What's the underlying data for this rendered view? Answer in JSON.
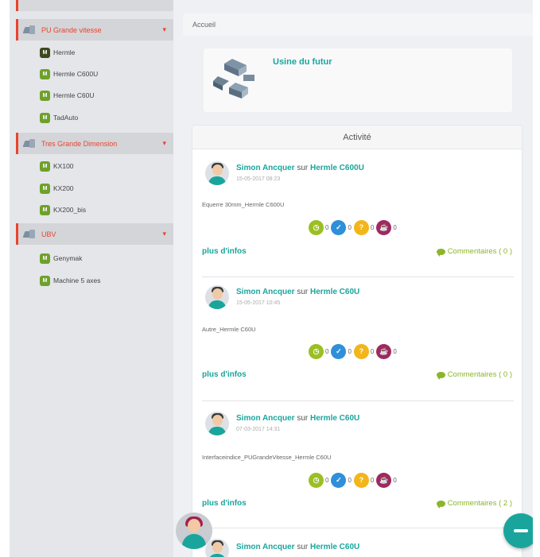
{
  "sidebar": {
    "groups": [
      {
        "label": "PU Grande vitesse",
        "items": [
          {
            "badge": "M",
            "label": "Hermle"
          },
          {
            "badge": "M",
            "label": "Hermle C600U"
          },
          {
            "badge": "M",
            "label": "Hermle C60U"
          },
          {
            "badge": "M",
            "label": "TadAuto"
          }
        ]
      },
      {
        "label": "Tres Grande Dimension",
        "items": [
          {
            "badge": "M",
            "label": "KX100"
          },
          {
            "badge": "M",
            "label": "KX200"
          },
          {
            "badge": "M",
            "label": "KX200_bis"
          }
        ]
      },
      {
        "label": "UBV",
        "items": [
          {
            "badge": "M",
            "label": "Genymak"
          },
          {
            "badge": "M",
            "label": "Machine 5 axes"
          }
        ]
      }
    ],
    "arrow": "▾"
  },
  "breadcrumb": "Accueil",
  "factory": {
    "title": "Usine du futur"
  },
  "activity": {
    "title": "Activité",
    "posts": [
      {
        "author": "Simon Ancquer",
        "sur": "sur",
        "machine": "Hermle C600U",
        "date": "15-05-2017 08:23",
        "text": "Equerre 30mm_Hermle C600U",
        "counts": [
          "0",
          "0",
          "0",
          "0"
        ],
        "more": "plus d'infos",
        "comments": "Commentaires ( 0 )"
      },
      {
        "author": "Simon Ancquer",
        "sur": "sur",
        "machine": "Hermle C60U",
        "date": "15-05-2017 10:45",
        "text": "Autre_Hermle C60U",
        "counts": [
          "0",
          "0",
          "0",
          "0"
        ],
        "more": "plus d'infos",
        "comments": "Commentaires ( 0 )"
      },
      {
        "author": "Simon Ancquer",
        "sur": "sur",
        "machine": "Hermle C60U",
        "date": "07-03-2017 14:31",
        "text": "Interfaceindice_PUGrandeVitesse_Hermle C60U",
        "counts": [
          "0",
          "0",
          "0",
          "0"
        ],
        "more": "plus d'infos",
        "comments": "Commentaires ( 2 )"
      },
      {
        "author": "Simon Ancquer",
        "sur": "sur",
        "machine": "Hermle C60U"
      }
    ]
  },
  "colors": {
    "accent": "#1aa59c",
    "sidebar_accent": "#e8442e",
    "comments": "#8bb52a"
  },
  "icons": {
    "fab": "minus-icon",
    "reactions": [
      "clock-icon",
      "thumbs-up-icon",
      "question-icon",
      "cup-icon"
    ]
  }
}
